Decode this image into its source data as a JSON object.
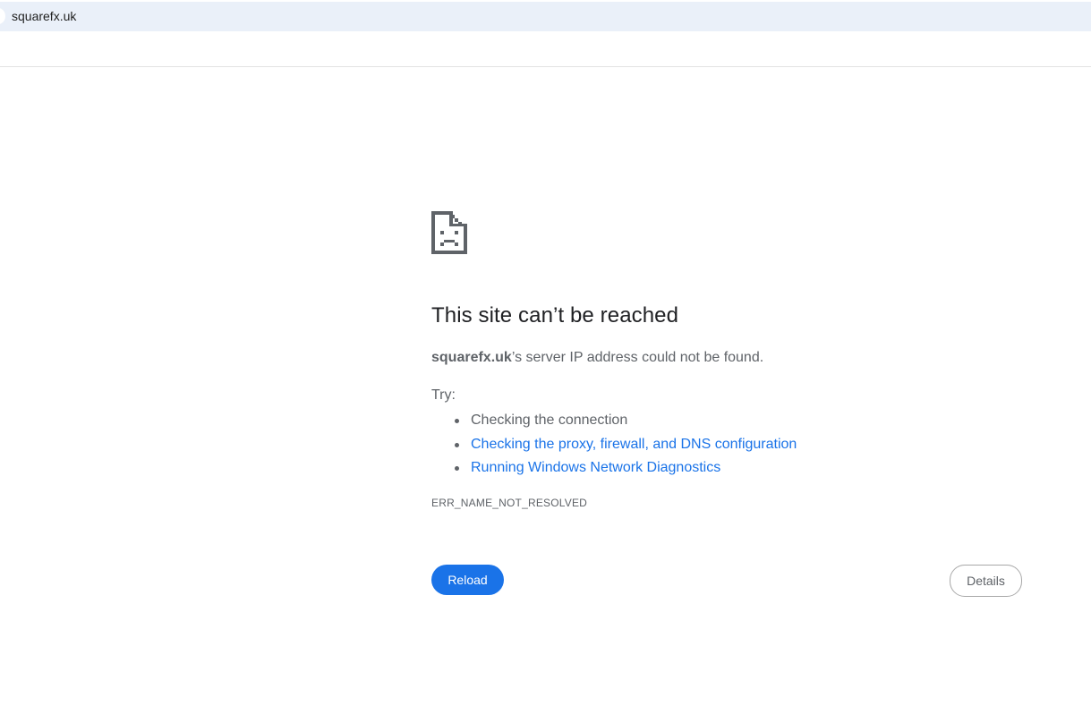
{
  "browser": {
    "address": "squarefx.uk"
  },
  "error": {
    "headline": "This site can’t be reached",
    "host": "squarefx.uk",
    "summary_suffix": "’s server IP address could not be found.",
    "try_label": "Try:",
    "suggestions": [
      {
        "label": "Checking the connection",
        "link": false
      },
      {
        "label": "Checking the proxy, firewall, and DNS configuration",
        "link": true
      },
      {
        "label": "Running Windows Network Diagnostics",
        "link": true
      }
    ],
    "code": "ERR_NAME_NOT_RESOLVED",
    "icon": "sad-page-icon"
  },
  "buttons": {
    "reload_label": "Reload",
    "details_label": "Details"
  },
  "colors": {
    "accent": "#1a73e8",
    "text_secondary": "#5f6368",
    "address_bar_bg": "#eaf0f9"
  }
}
